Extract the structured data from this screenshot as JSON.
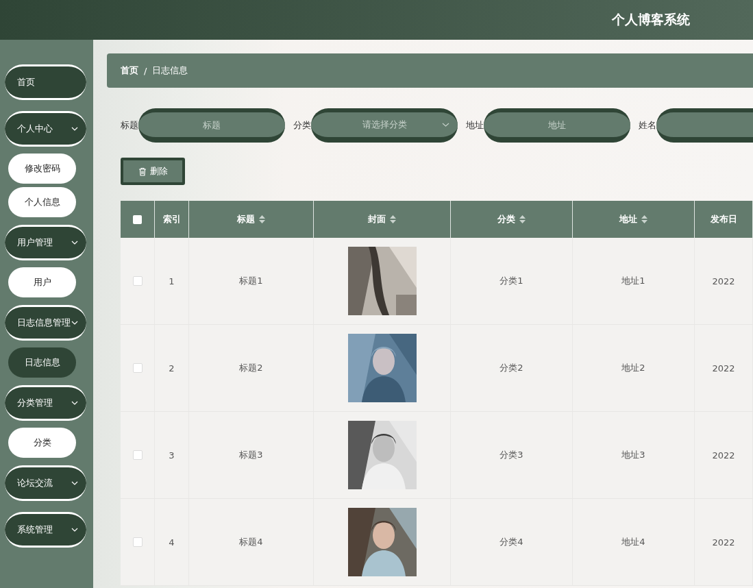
{
  "header": {
    "title": "个人博客系统"
  },
  "sidebar": {
    "items": [
      {
        "label": "首页",
        "expandable": false
      },
      {
        "label": "个人中心",
        "expandable": true,
        "children": [
          {
            "label": "修改密码",
            "selected": false
          },
          {
            "label": "个人信息",
            "selected": false
          }
        ]
      },
      {
        "label": "用户管理",
        "expandable": true,
        "children": [
          {
            "label": "用户",
            "selected": false
          }
        ]
      },
      {
        "label": "日志信息管理",
        "expandable": true,
        "children": [
          {
            "label": "日志信息",
            "selected": true
          }
        ]
      },
      {
        "label": "分类管理",
        "expandable": true,
        "children": [
          {
            "label": "分类",
            "selected": false
          }
        ]
      },
      {
        "label": "论坛交流",
        "expandable": true
      },
      {
        "label": "系统管理",
        "expandable": true
      }
    ]
  },
  "breadcrumb": [
    "首页",
    "/",
    "日志信息"
  ],
  "filters": [
    {
      "label": "标题",
      "kind": "input",
      "placeholder": "标题"
    },
    {
      "label": "分类",
      "kind": "select",
      "placeholder": "请选择分类"
    },
    {
      "label": "地址",
      "kind": "input",
      "placeholder": "地址"
    },
    {
      "label": "姓名",
      "kind": "input"
    }
  ],
  "delete_button": "删除",
  "table": {
    "select_all": {
      "checked": false
    },
    "columns": [
      {
        "label": "索引",
        "sortable": false
      },
      {
        "label": "标题",
        "sortable": true
      },
      {
        "label": "封面",
        "sortable": true
      },
      {
        "label": "分类",
        "sortable": true
      },
      {
        "label": "地址",
        "sortable": true
      },
      {
        "label": "发布日",
        "sortable": false
      }
    ],
    "rows": [
      {
        "checked": false,
        "index": "1",
        "title": "标题1",
        "category": "分类1",
        "address": "地址1",
        "date": "2022"
      },
      {
        "checked": false,
        "index": "2",
        "title": "标题2",
        "category": "分类2",
        "address": "地址2",
        "date": "2022"
      },
      {
        "checked": false,
        "index": "3",
        "title": "标题3",
        "category": "分类3",
        "address": "地址3",
        "date": "2022"
      },
      {
        "checked": false,
        "index": "4",
        "title": "标题4",
        "category": "分类4",
        "address": "地址4",
        "date": "2022"
      }
    ]
  }
}
